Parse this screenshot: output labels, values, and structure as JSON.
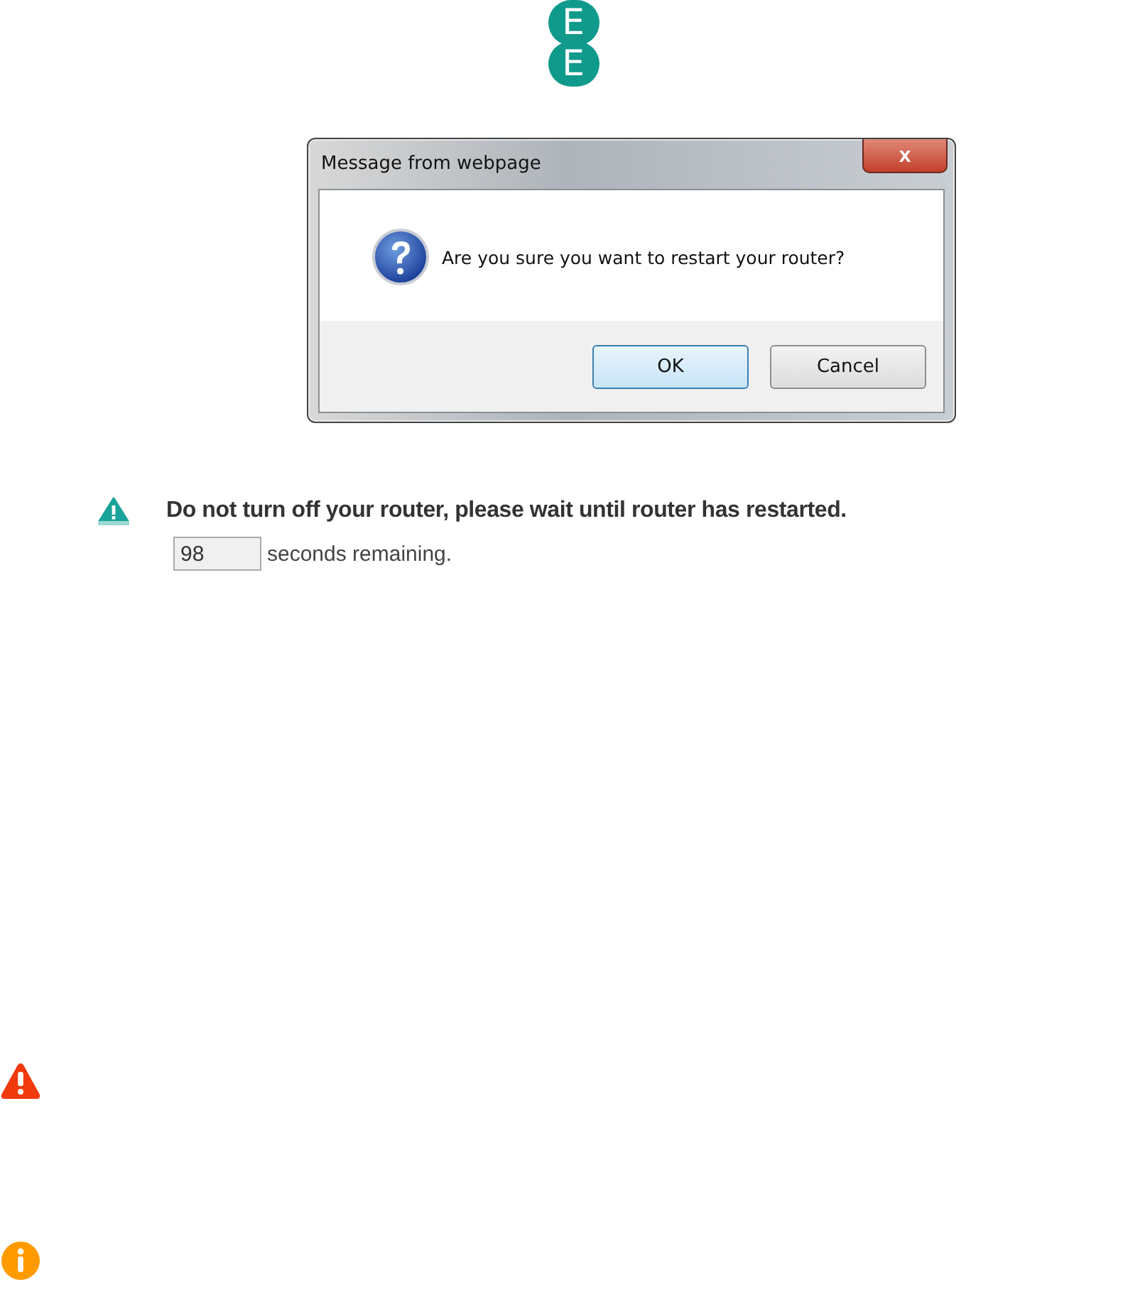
{
  "logo": {
    "letters": [
      "E",
      "E"
    ]
  },
  "dialog": {
    "title": "Message from webpage",
    "close": "x",
    "message": "Are you sure you want to restart your router?",
    "buttons": [
      {
        "label": "OK",
        "selected": true
      },
      {
        "label": "Cancel",
        "selected": false
      }
    ]
  },
  "warning": {
    "message": "Do not turn off your router, please wait until router has restarted."
  },
  "countdown": {
    "value": "98",
    "label": "seconds remaining."
  },
  "status_icons": [
    {
      "kind": "error"
    },
    {
      "kind": "info"
    }
  ]
}
